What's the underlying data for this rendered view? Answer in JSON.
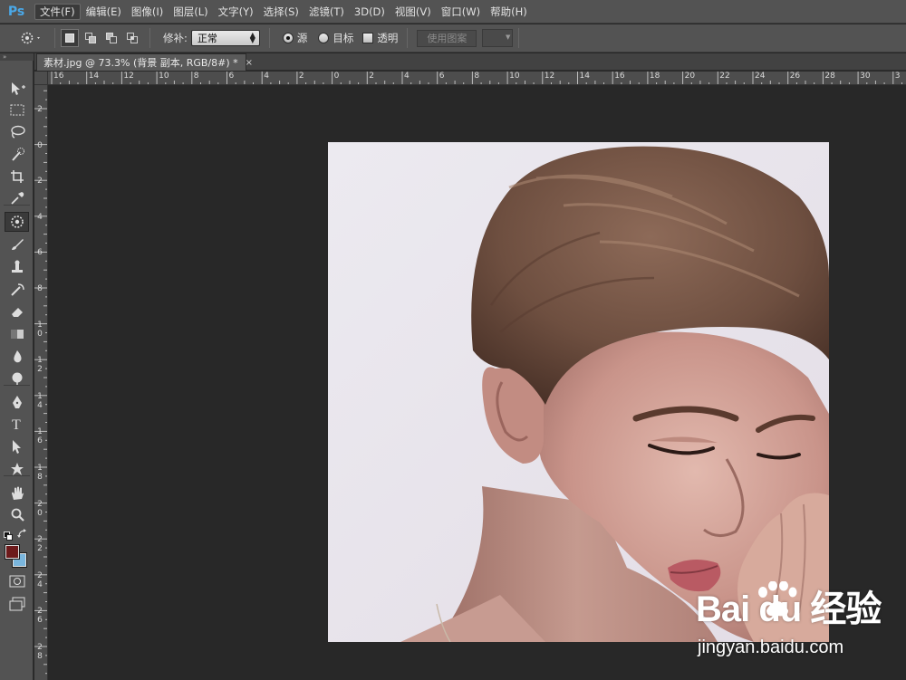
{
  "app": {
    "logo": "Ps"
  },
  "menu": [
    {
      "label": "文件(F)",
      "active": true
    },
    {
      "label": "编辑(E)"
    },
    {
      "label": "图像(I)"
    },
    {
      "label": "图层(L)"
    },
    {
      "label": "文字(Y)"
    },
    {
      "label": "选择(S)"
    },
    {
      "label": "滤镜(T)"
    },
    {
      "label": "3D(D)"
    },
    {
      "label": "视图(V)"
    },
    {
      "label": "窗口(W)"
    },
    {
      "label": "帮助(H)"
    }
  ],
  "options": {
    "patch_label": "修补:",
    "patch_mode": "正常",
    "source_label": "源",
    "destination_label": "目标",
    "transparent_label": "透明",
    "use_pattern_label": "使用图案"
  },
  "document": {
    "tab_title": "素材.jpg @ 73.3% (背景 副本, RGB/8#) *",
    "close_glyph": "×"
  },
  "ruler_h_labels": [
    "16",
    "14",
    "12",
    "10",
    "8",
    "6",
    "4",
    "2",
    "0",
    "2",
    "4",
    "6",
    "8",
    "10",
    "12",
    "14",
    "16",
    "18",
    "20",
    "22",
    "24",
    "26",
    "28",
    "30",
    "3"
  ],
  "ruler_v_labels": [
    "2",
    "0",
    "2",
    "4",
    "6",
    "8",
    "1 0",
    "1 2",
    "1 4",
    "1 6",
    "1 8",
    "2 0",
    "2 2",
    "2 4",
    "2 6",
    "2 8"
  ],
  "tools": [
    "move-tool",
    "marquee-tool",
    "lasso-tool",
    "quick-selection-tool",
    "crop-tool",
    "eyedropper-tool",
    "patch-tool",
    "brush-tool",
    "clone-stamp-tool",
    "history-brush-tool",
    "eraser-tool",
    "gradient-tool",
    "blur-tool",
    "dodge-tool",
    "pen-tool",
    "type-tool",
    "path-selection-tool",
    "shape-tool",
    "hand-tool",
    "zoom-tool"
  ],
  "colors": {
    "foreground": "#6d1a1b",
    "background": "#7ab6dd",
    "workspace": "#282828",
    "panel": "#535353"
  },
  "watermark": {
    "logo_text": "Bai du 经验",
    "url": "jingyan.baidu.com"
  }
}
